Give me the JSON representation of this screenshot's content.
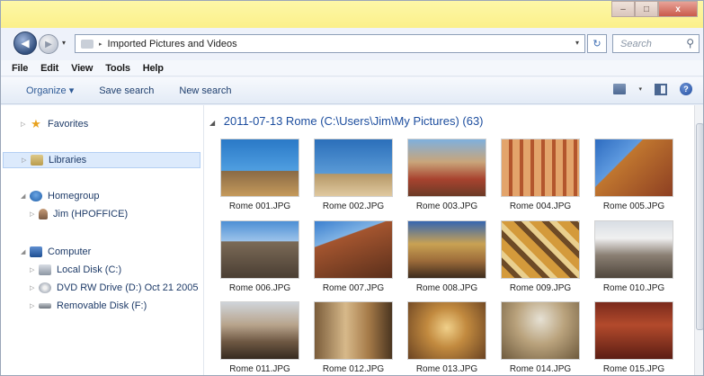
{
  "window": {
    "controls": {
      "minimize": "–",
      "maximize": "□",
      "close": "x"
    }
  },
  "navbar": {
    "back_glyph": "◀",
    "forward_glyph": "▶",
    "recent_glyph": "▾",
    "address_arrow": "▸",
    "address_text": "Imported Pictures and Videos",
    "address_drop": "▾",
    "refresh_glyph": "↻",
    "search_placeholder": "Search",
    "search_glyph": "⚲"
  },
  "menu": [
    "File",
    "Edit",
    "View",
    "Tools",
    "Help"
  ],
  "toolbar": {
    "organize": "Organize ▾",
    "save_search": "Save search",
    "new_search": "New search",
    "views_drop": "▾",
    "help": "?"
  },
  "nav": {
    "favorites": "Favorites",
    "libraries": "Libraries",
    "homegroup": "Homegroup",
    "homegroup_user": "Jim (HPOFFICE)",
    "computer": "Computer",
    "local_disk": "Local Disk (C:)",
    "dvd_drive": "DVD RW Drive (D:) Oct 21 2005",
    "removable": "Removable Disk (F:)"
  },
  "content": {
    "group_header": "2011-07-13 Rome (C:\\Users\\Jim\\My Pictures) (63)",
    "thumbnails": [
      "Rome 001.JPG",
      "Rome 002.JPG",
      "Rome 003.JPG",
      "Rome 004.JPG",
      "Rome 005.JPG",
      "Rome 006.JPG",
      "Rome 007.JPG",
      "Rome 008.JPG",
      "Rome 009.JPG",
      "Rome 010.JPG",
      "Rome 011.JPG",
      "Rome 012.JPG",
      "Rome 013.JPG",
      "Rome 014.JPG",
      "Rome 015.JPG"
    ]
  },
  "colors": {
    "title_bar": "#fbf08a",
    "link_blue": "#1c4d9e",
    "selection": "#dceafc"
  }
}
